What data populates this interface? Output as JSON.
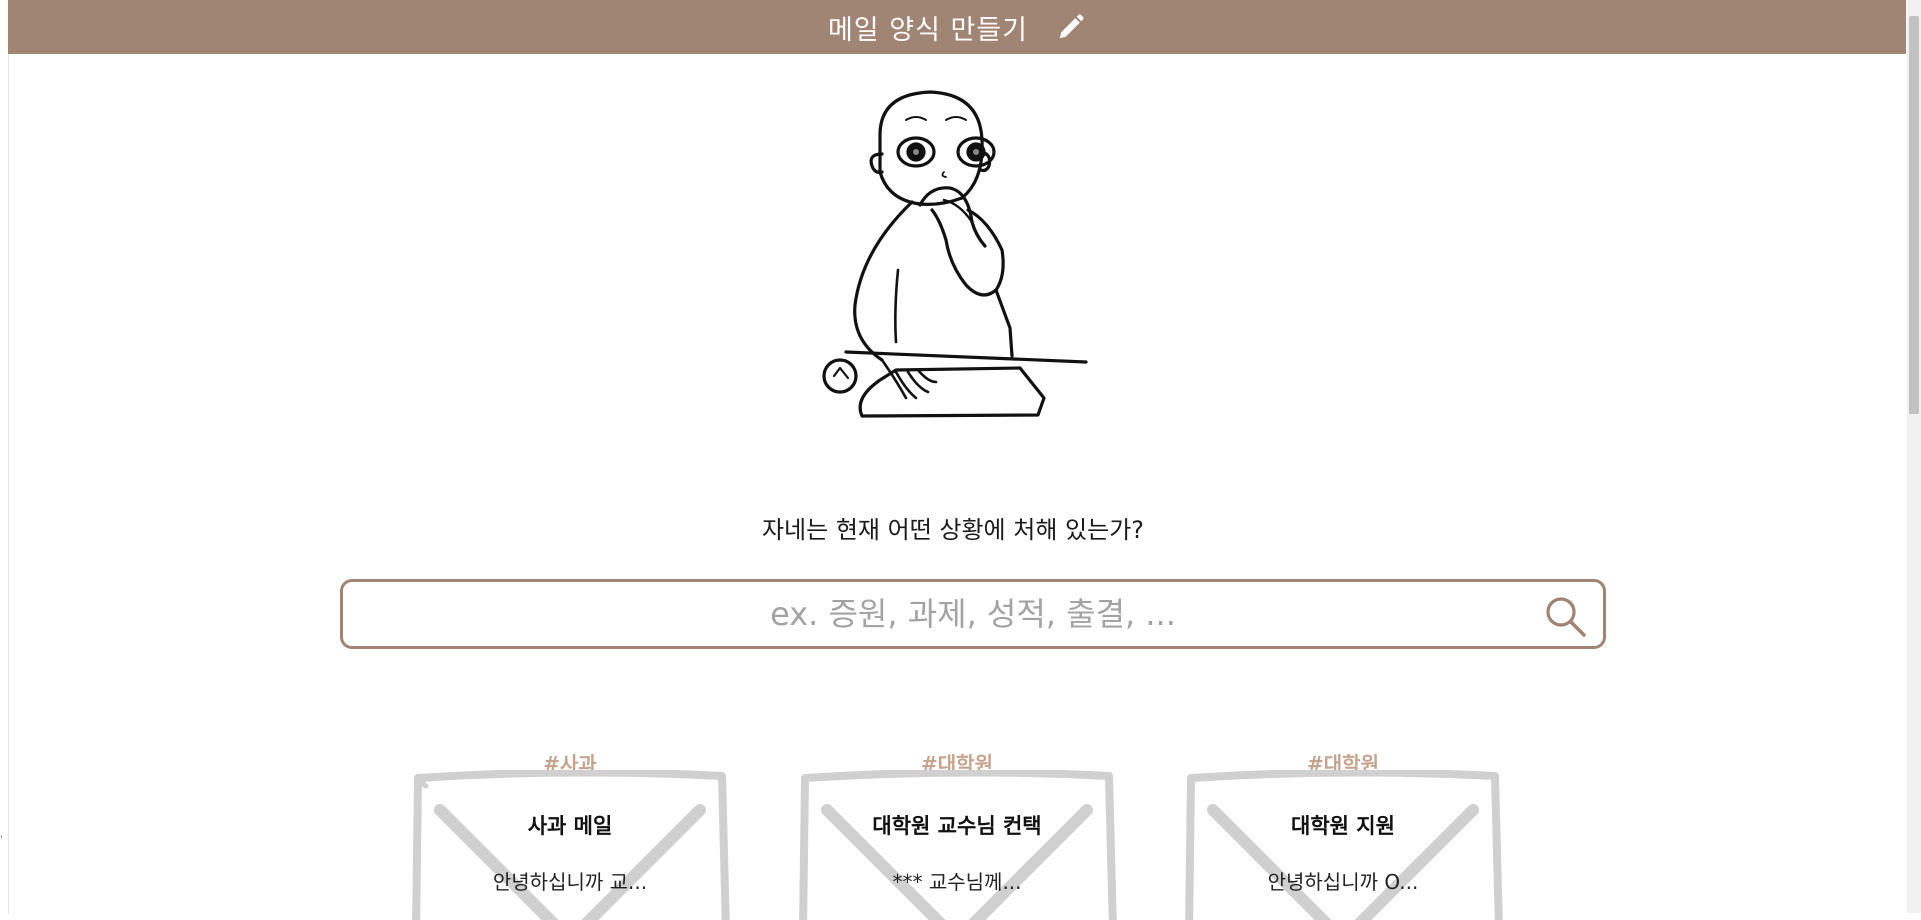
{
  "header": {
    "title": "메일 양식 만들기",
    "icon": "pencil-icon"
  },
  "colors": {
    "brand": "#a08474",
    "tag": "#c4a48e",
    "envelope": "#d0d0d0"
  },
  "question": "자네는 현재 어떤 상황에 처해 있는가?",
  "search": {
    "placeholder": "ex. 증원, 과제, 성적, 출결, ...",
    "value": "",
    "icon": "search-icon"
  },
  "cards": [
    {
      "tag": "#사과",
      "title": "사과 메일",
      "preview": "안녕하십니까 교..."
    },
    {
      "tag": "#대학원",
      "title": "대학원 교수님 컨택",
      "preview": "*** 교수님께..."
    },
    {
      "tag": "#대학원",
      "title": "대학원 지원",
      "preview": "안녕하십니까 O..."
    }
  ]
}
